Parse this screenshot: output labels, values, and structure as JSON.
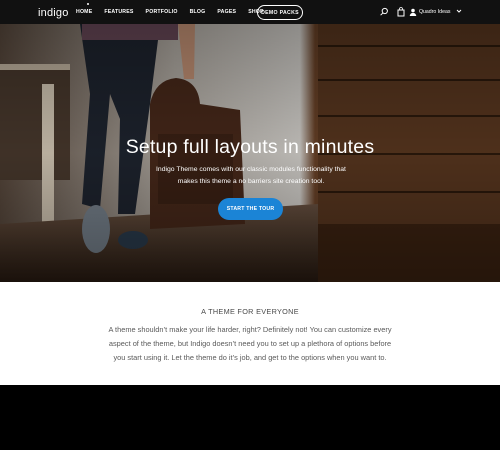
{
  "brand": {
    "logo_text": "indigo"
  },
  "nav": {
    "items": [
      "HOME",
      "FEATURES",
      "PORTFOLIO",
      "BLOG",
      "PAGES",
      "SHOP"
    ],
    "demo_label": "DEMO PACKS"
  },
  "header": {
    "account_name": "Quadro Ideas",
    "icons": [
      "search-icon",
      "bag-icon",
      "user-icon",
      "chevron-down-icon"
    ]
  },
  "hero": {
    "title": "Setup full layouts in minutes",
    "subtitle": "Indigo Theme comes with our classic modules functionality that makes this theme a no barriers site creation tool.",
    "cta_label": "START THE TOUR",
    "accent": "#1b84d6"
  },
  "section": {
    "eyebrow": "A THEME FOR EVERYONE",
    "paragraph": "A theme shouldn’t make your life harder, right? Definitely not! You can customize every aspect of the theme, but Indigo doesn’t need you to set up a plethora of options before you start using it. Let the theme do it’s job, and get to the options when you want to."
  }
}
